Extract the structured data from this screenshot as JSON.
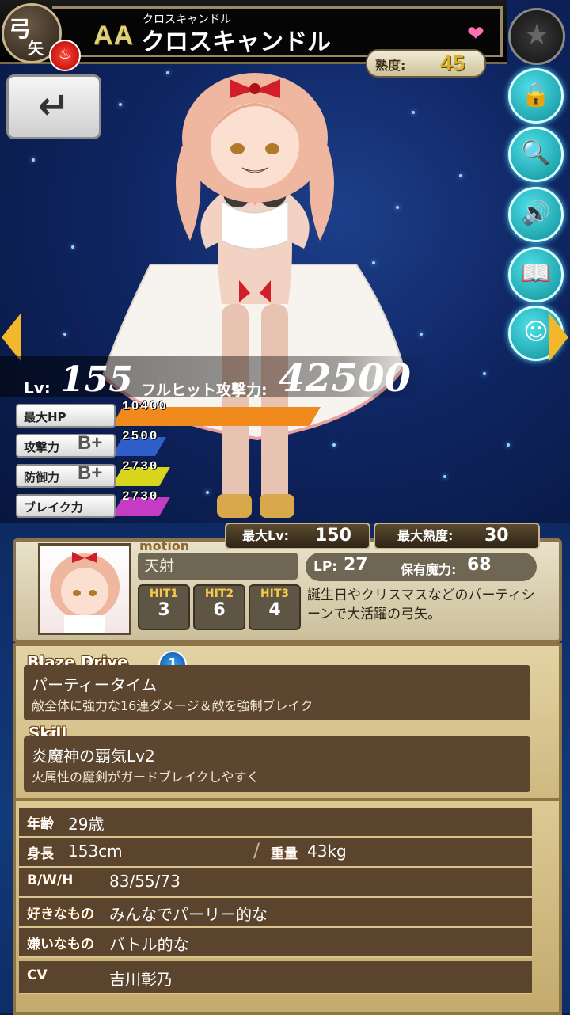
{
  "header": {
    "class_kanji_1": "弓",
    "class_kanji_2": "矢",
    "element_icon": "fire-element-icon",
    "rank": "AA",
    "name_ruby": "クロスキャンドル",
    "name": "クロスキャンドル",
    "proficiency_label": "熟度:",
    "proficiency_value": "45",
    "favorite_icon": "heart-icon",
    "colors": {
      "rank": "#e0d07a",
      "heart": "#ff6fb1",
      "accent": "#f2b72a"
    }
  },
  "nav": {
    "back_icon": "return-arrow-icon",
    "side_buttons": [
      "star-icon",
      "lock-icon",
      "magnifier-icon",
      "speaker-icon",
      "book-icon",
      "character-icon"
    ]
  },
  "stats": {
    "lv_label": "Lv:",
    "lv_value": "155",
    "fullhit_label": "フルヒット攻撃力:",
    "fullhit_value": "42500",
    "rows": [
      {
        "label": "最大HP",
        "grade": "",
        "value": "10400",
        "fill": 1.0,
        "color": "#f08a1c"
      },
      {
        "label": "攻撃力",
        "grade": "B+",
        "value": "2500",
        "fill": 0.22,
        "color": "#2f5fc8"
      },
      {
        "label": "防御力",
        "grade": "B+",
        "value": "2730",
        "fill": 0.24,
        "color": "#d9d51c"
      },
      {
        "label": "ブレイク力",
        "grade": "",
        "value": "2730",
        "fill": 0.24,
        "color": "#c43cc4"
      }
    ]
  },
  "info": {
    "max_lv_label": "最大Lv:",
    "max_lv_value": "150",
    "max_prof_label": "最大熟度:",
    "max_prof_value": "30",
    "motion_label": "motion",
    "motion_value": "天射",
    "hits": [
      {
        "label": "HIT1",
        "value": "3"
      },
      {
        "label": "HIT2",
        "value": "6"
      },
      {
        "label": "HIT3",
        "value": "4"
      }
    ],
    "lp_label": "LP:",
    "lp_value": "27",
    "mana_label": "保有魔力:",
    "mana_value": "68",
    "description": "誕生日やクリスマスなどのパーティシーンで大活躍の弓矢。"
  },
  "blaze": {
    "title": "Blaze Drive",
    "badge": "1",
    "name": "パーティータイム",
    "desc": "敵全体に強力な16連ダメージ＆敵を強制ブレイク"
  },
  "skill": {
    "title": "Skill",
    "name": "炎魔神の覇気Lv2",
    "desc": "火属性の魔剣がガードブレイクしやすく"
  },
  "profile": {
    "age_label": "年齢",
    "age_value": "29歳",
    "height_label": "身長",
    "height_value": "153cm",
    "weight_label": "重量",
    "weight_value": "43kg",
    "bwh_label": "B/W/H",
    "bwh_value": "83/55/73",
    "likes_label": "好きなもの",
    "likes_value": "みんなでパーリー的な",
    "dislikes_label": "嫌いなもの",
    "dislikes_value": "バトル的な",
    "cv_label": "CV",
    "cv_value": "吉川彰乃"
  }
}
